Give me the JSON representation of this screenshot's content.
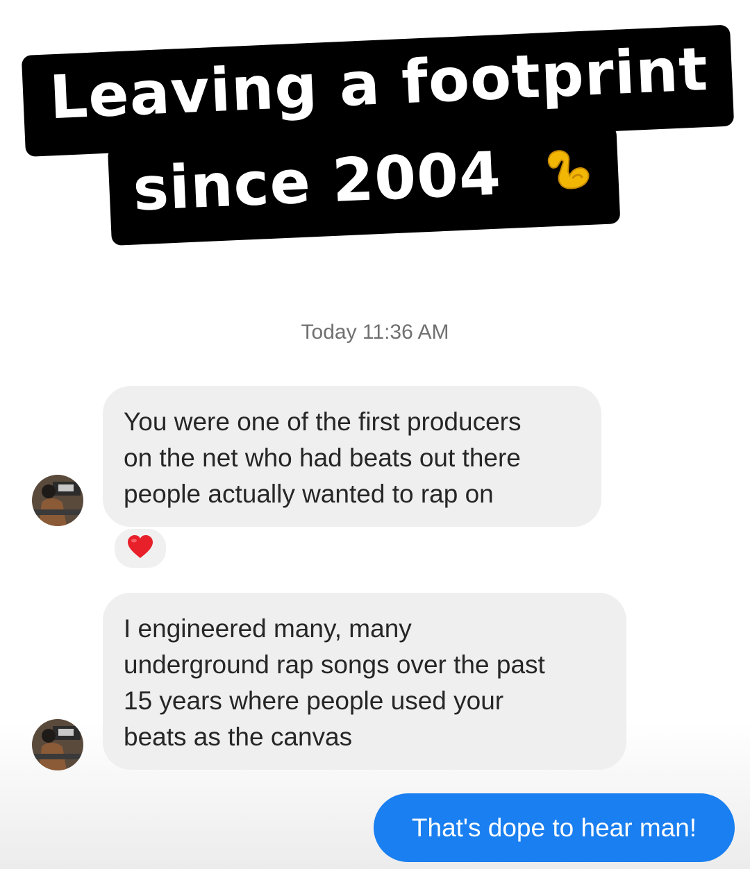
{
  "caption": {
    "line1": "Leaving a footprint",
    "line2": "since 2004",
    "emoji": "flexed-biceps-icon"
  },
  "thread": {
    "timestamp": "Today 11:36 AM",
    "messages": [
      {
        "sender": "other",
        "lines": [
          "You were one of the first producers",
          "on the net who had beats out there",
          "people actually wanted to rap on"
        ],
        "reaction": "heart-icon"
      },
      {
        "sender": "other",
        "lines": [
          "I engineered many, many",
          "underground rap songs over the past",
          "15 years where people used your",
          "beats as the canvas"
        ]
      },
      {
        "sender": "me",
        "text": "That's dope to hear man!"
      }
    ]
  },
  "colors": {
    "incoming_bubble": "#efefef",
    "outgoing_bubble": "#1a7ff0",
    "reaction_heart": "#e8202a",
    "emoji_arm": "#f2b705"
  }
}
